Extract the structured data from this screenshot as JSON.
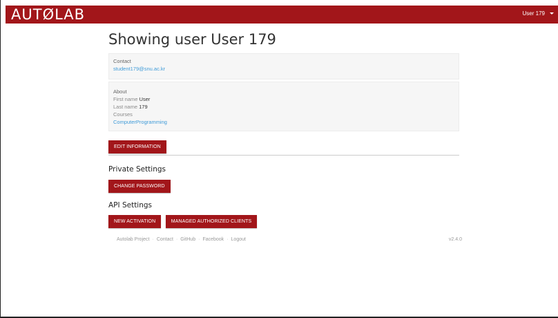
{
  "navbar": {
    "brand": "AUTØLAB",
    "user_menu_label": "User 179"
  },
  "page_title": "Showing user User 179",
  "contact": {
    "heading": "Contact",
    "email": "student179@snu.ac.kr"
  },
  "about": {
    "heading": "About",
    "first_name_label": "First name",
    "first_name_value": "User",
    "last_name_label": "Last name",
    "last_name_value": "179",
    "courses_label": "Courses",
    "courses": [
      "ComputerProgramming"
    ]
  },
  "buttons": {
    "edit_information": "EDIT INFORMATION",
    "change_password": "CHANGE PASSWORD",
    "new_activation": "NEW ACTIVATION",
    "managed_authorized_clients": "MANAGED AUTHORIZED CLIENTS"
  },
  "sections": {
    "private_settings": "Private Settings",
    "api_settings": "API Settings"
  },
  "footer": {
    "links": [
      "Autolab Project",
      "Contact",
      "GitHub",
      "Facebook",
      "Logout"
    ],
    "separator": "·",
    "version": "v2.4.0"
  },
  "colors": {
    "brand_red": "#a2161a",
    "link_blue": "#3f9bd8"
  }
}
